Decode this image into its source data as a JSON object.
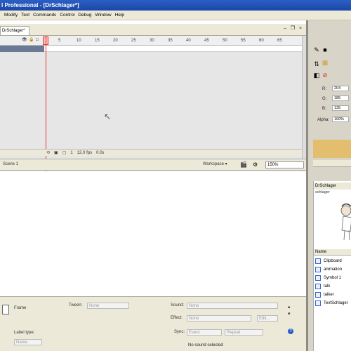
{
  "window": {
    "title": "l Professional - [DrSchlager*]"
  },
  "menu": [
    "Modify",
    "Text",
    "Commands",
    "Control",
    "Debug",
    "Window",
    "Help"
  ],
  "document": {
    "tab": "DrSchlager*"
  },
  "timeline": {
    "frame_numbers": [
      "5",
      "10",
      "15",
      "20",
      "25",
      "30",
      "35",
      "40",
      "45",
      "50",
      "55",
      "60",
      "65"
    ],
    "status": {
      "current_frame": "1",
      "fps": "12.0 fps",
      "elapsed": "0.0s"
    }
  },
  "editbar": {
    "scene": "Scene 1",
    "workspace": "Workspace ▾",
    "zoom": "150%"
  },
  "properties": {
    "frame_label": "Frame",
    "tween_label": "Tween:",
    "tween_value": "None",
    "sound_label": "Sound:",
    "sound_value": "None",
    "effect_label": "Effect:",
    "effect_value": "None",
    "sync_label": "Sync:",
    "sync_value": "Event",
    "repeat_value": "Repeat",
    "label_type_label": "Label type:",
    "label_type_value": "Name",
    "no_sound": "No sound selected"
  },
  "info_panel": {
    "fields": [
      {
        "label": "R:",
        "value": "204"
      },
      {
        "label": "G:",
        "value": "185"
      },
      {
        "label": "B:",
        "value": "135"
      },
      {
        "label": "Alpha:",
        "value": "100%"
      }
    ]
  },
  "library": {
    "title": "DrSchlager",
    "subhead": "schlager",
    "col_name": "Name",
    "items": [
      "Clipboard",
      "animation",
      "Symbol 1",
      "talk",
      "talker",
      "TextSchlager"
    ]
  },
  "colors": {
    "titlebar": "#1a47a8",
    "chrome": "#ece9d8",
    "playhead": "#e33333",
    "fill_swatch": "#e3be6f"
  }
}
